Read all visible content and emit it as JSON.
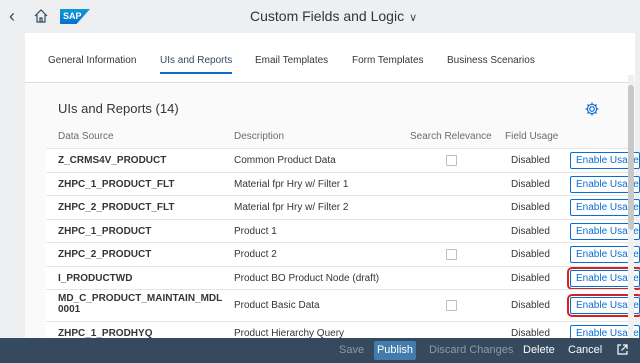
{
  "shell": {
    "back_icon": "chevron-left-icon",
    "home_icon": "home-icon",
    "logo_text": "SAP",
    "title": "Custom Fields and Logic",
    "title_chevron": "∨"
  },
  "tabs": [
    {
      "label": "General Information",
      "active": false
    },
    {
      "label": "UIs and Reports",
      "active": true
    },
    {
      "label": "Email Templates",
      "active": false
    },
    {
      "label": "Form Templates",
      "active": false
    },
    {
      "label": "Business Scenarios",
      "active": false
    }
  ],
  "section": {
    "title": "UIs and Reports (14)",
    "settings_icon": "gear-icon"
  },
  "table": {
    "columns": [
      "Data Source",
      "Description",
      "Search Relevance",
      "Field Usage"
    ],
    "rows": [
      {
        "data_source": "Z_CRMS4V_PRODUCT",
        "description": "Common Product Data",
        "checkbox": true,
        "usage": "Disabled",
        "action": "Enable Usage"
      },
      {
        "data_source": "ZHPC_1_PRODUCT_FLT",
        "description": "Material fpr Hry w/ Filter 1",
        "checkbox": false,
        "usage": "Disabled",
        "action": "Enable Usage"
      },
      {
        "data_source": "ZHPC_2_PRODUCT_FLT",
        "description": "Material fpr Hry w/ Filter 2",
        "checkbox": false,
        "usage": "Disabled",
        "action": "Enable Usage"
      },
      {
        "data_source": "ZHPC_1_PRODUCT",
        "description": "Product 1",
        "checkbox": false,
        "usage": "Disabled",
        "action": "Enable Usage"
      },
      {
        "data_source": "ZHPC_2_PRODUCT",
        "description": "Product 2",
        "checkbox": true,
        "usage": "Disabled",
        "action": "Enable Usage"
      },
      {
        "data_source": "I_PRODUCTWD",
        "description": "Product BO Product Node (draft)",
        "checkbox": false,
        "usage": "Disabled",
        "action": "Enable Usage",
        "highlighted": true
      },
      {
        "data_source": "MD_C_PRODUCT_MAINTAIN_MDL",
        "data_source_line2": "0001",
        "description": "Product Basic Data",
        "checkbox": true,
        "usage": "Disabled",
        "action": "Enable Usage",
        "highlighted": true
      },
      {
        "data_source": "ZHPC_1_PRODHYQ",
        "description": "Product Hierarchy Query",
        "checkbox": false,
        "usage": "Disabled",
        "action": "Enable Usage"
      }
    ]
  },
  "footer": {
    "save": "Save",
    "publish": "Publish",
    "discard": "Discard Changes",
    "delete": "Delete",
    "cancel": "Cancel",
    "external_icon": "external-link-icon"
  }
}
